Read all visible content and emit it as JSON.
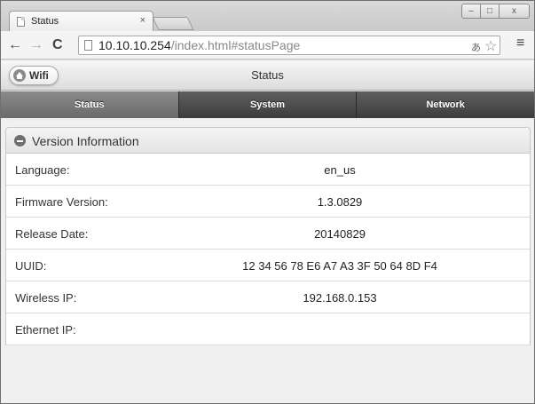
{
  "browser": {
    "tab_title": "Status",
    "tab_close": "×",
    "window_controls": {
      "minimize": "–",
      "maximize": "□",
      "close": "x"
    },
    "url_host": "10.10.10.254",
    "url_path": "/index.html#statusPage",
    "icons": [
      "back-icon",
      "forward-icon",
      "reload-icon",
      "page-icon",
      "translate-icon",
      "star-icon",
      "menu-icon"
    ]
  },
  "header": {
    "back_button_label": "Wifi",
    "title": "Status"
  },
  "navbar": {
    "tabs": [
      {
        "label": "Status",
        "active": true
      },
      {
        "label": "System",
        "active": false
      },
      {
        "label": "Network",
        "active": false
      }
    ]
  },
  "section": {
    "title": "Version Information",
    "rows": [
      {
        "label": "Language:",
        "value": "en_us"
      },
      {
        "label": "Firmware Version:",
        "value": "1.3.0829"
      },
      {
        "label": "Release Date:",
        "value": "20140829"
      },
      {
        "label": "UUID:",
        "value": "12 34 56 78 E6 A7 A3 3F 50 64 8D F4"
      },
      {
        "label": "Wireless IP:",
        "value": "192.168.0.153"
      },
      {
        "label": "Ethernet IP:",
        "value": ""
      }
    ]
  }
}
